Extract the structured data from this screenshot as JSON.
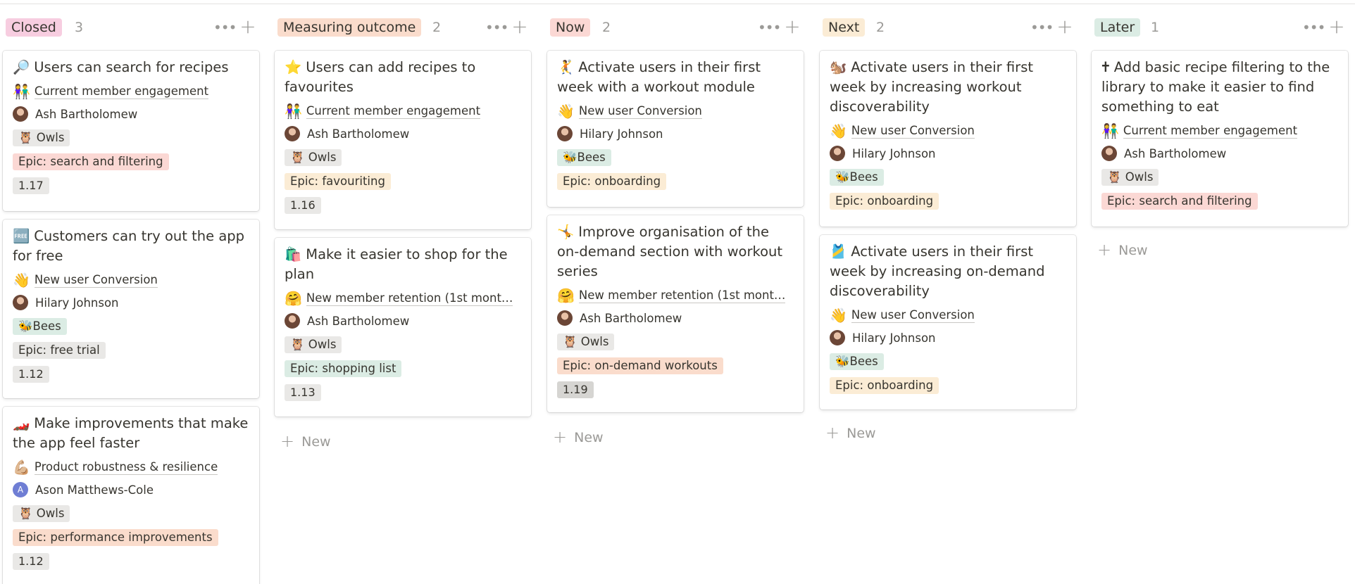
{
  "board": {
    "new_label": "New",
    "columns": [
      {
        "name": "Closed",
        "count": "3",
        "pill_color": "#f7cde0",
        "cards": [
          {
            "icon": "🔎",
            "title": "Users can search for recipes",
            "relation_icon": "👫",
            "relation": "Current member engagement",
            "person": "Ash Bartholomew",
            "team_icon": "🦉",
            "team": "Owls",
            "epic": "Epic: search and filtering",
            "epic_color": "#fbd8d4",
            "version": "1.17"
          },
          {
            "icon": "🆓",
            "title": "Customers can try out the app for free",
            "relation_icon": "👋",
            "relation": "New user Conversion",
            "person": "Hilary Johnson",
            "team_icon": "🐝",
            "team": "Bees",
            "epic": "Epic: free trial",
            "epic_color": "#e9e8e6",
            "version": "1.12"
          },
          {
            "icon": "🏎️",
            "title": "Make improvements that make the app feel faster",
            "relation_icon": "💪🏼",
            "relation": "Product robustness & resilience",
            "person": "Ason Matthews-Cole",
            "team_icon": "🦉",
            "team": "Owls",
            "epic": "Epic: performance improvements",
            "epic_color": "#fadccc",
            "version": "1.12"
          }
        ]
      },
      {
        "name": "Measuring outcome",
        "count": "2",
        "pill_color": "#fadccc",
        "cards": [
          {
            "icon": "⭐",
            "title": "Users can add recipes to favourites",
            "relation_icon": "👫",
            "relation": "Current member engagement",
            "person": "Ash Bartholomew",
            "team_icon": "🦉",
            "team": "Owls",
            "epic": "Epic: favouriting",
            "epic_color": "#fbecd5",
            "version": "1.16"
          },
          {
            "icon": "🛍️",
            "title": "Make it easier to shop for the plan",
            "relation_icon": "🤗",
            "relation": "New member retention (1st mont…",
            "person": "Ash Bartholomew",
            "team_icon": "🦉",
            "team": "Owls",
            "epic": "Epic: shopping list",
            "epic_color": "#dbece4",
            "version": "1.13"
          }
        ]
      },
      {
        "name": "Now",
        "count": "2",
        "pill_color": "#fbd8d4",
        "cards": [
          {
            "icon": "🤾",
            "title": "Activate users in their first week with a workout module",
            "relation_icon": "👋",
            "relation": "New user Conversion",
            "person": "Hilary Johnson",
            "team_icon": "🐝",
            "team": "Bees",
            "epic": "Epic: onboarding",
            "epic_color": "#fbecd5",
            "version": ""
          },
          {
            "icon": "🤸",
            "title": "Improve organisation of the on-demand section with workout series",
            "relation_icon": "🤗",
            "relation": "New member retention (1st mont…",
            "person": "Ash Bartholomew",
            "team_icon": "🦉",
            "team": "Owls",
            "epic": "Epic: on-demand workouts",
            "epic_color": "#fadccc",
            "version": "1.19"
          }
        ]
      },
      {
        "name": "Next",
        "count": "2",
        "pill_color": "#fbecd5",
        "cards": [
          {
            "icon": "🐿️",
            "title": "Activate users in their first week by increasing workout discoverability",
            "relation_icon": "👋",
            "relation": "New user Conversion",
            "person": "Hilary Johnson",
            "team_icon": "🐝",
            "team": "Bees",
            "epic": "Epic: onboarding",
            "epic_color": "#fbecd5",
            "version": ""
          },
          {
            "icon": "🎽",
            "title": "Activate users in their first week by increasing on-demand discoverability",
            "relation_icon": "👋",
            "relation": "New user Conversion",
            "person": "Hilary Johnson",
            "team_icon": "🐝",
            "team": "Bees",
            "epic": "Epic: onboarding",
            "epic_color": "#fbecd5",
            "version": ""
          }
        ]
      },
      {
        "name": "Later",
        "count": "1",
        "pill_color": "#dbece4",
        "cards": [
          {
            "icon": "🕇",
            "title": "Add basic recipe filtering to the library to make it easier to find something to eat",
            "relation_icon": "👫",
            "relation": "Current member engagement",
            "person": "Ash Bartholomew",
            "team_icon": "🦉",
            "team": "Owls",
            "epic": "Epic: search and filtering",
            "epic_color": "#fbd8d4",
            "version": ""
          }
        ]
      }
    ]
  }
}
